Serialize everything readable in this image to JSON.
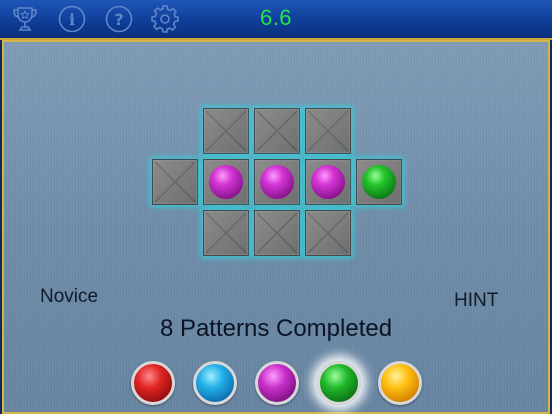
{
  "toolbar": {
    "icons": [
      "trophy-icon",
      "info-icon",
      "help-icon",
      "gear-icon"
    ],
    "score": "6.6"
  },
  "board": {
    "difficulty": "Novice",
    "hint_label": "HINT",
    "status": "8 Patterns Completed",
    "grid": [
      [
        "",
        "empty",
        "empty",
        "empty",
        ""
      ],
      [
        "empty",
        "purple",
        "purple",
        "purple",
        "green"
      ],
      [
        "",
        "empty",
        "empty",
        "empty",
        ""
      ]
    ]
  },
  "palette": {
    "colors": [
      "red",
      "blue",
      "purple",
      "green",
      "yellow"
    ],
    "selected": "green"
  },
  "colors": {
    "accent_border": "#d7b447",
    "score_text": "#22e34a",
    "cell_glow": "#28dce6"
  }
}
